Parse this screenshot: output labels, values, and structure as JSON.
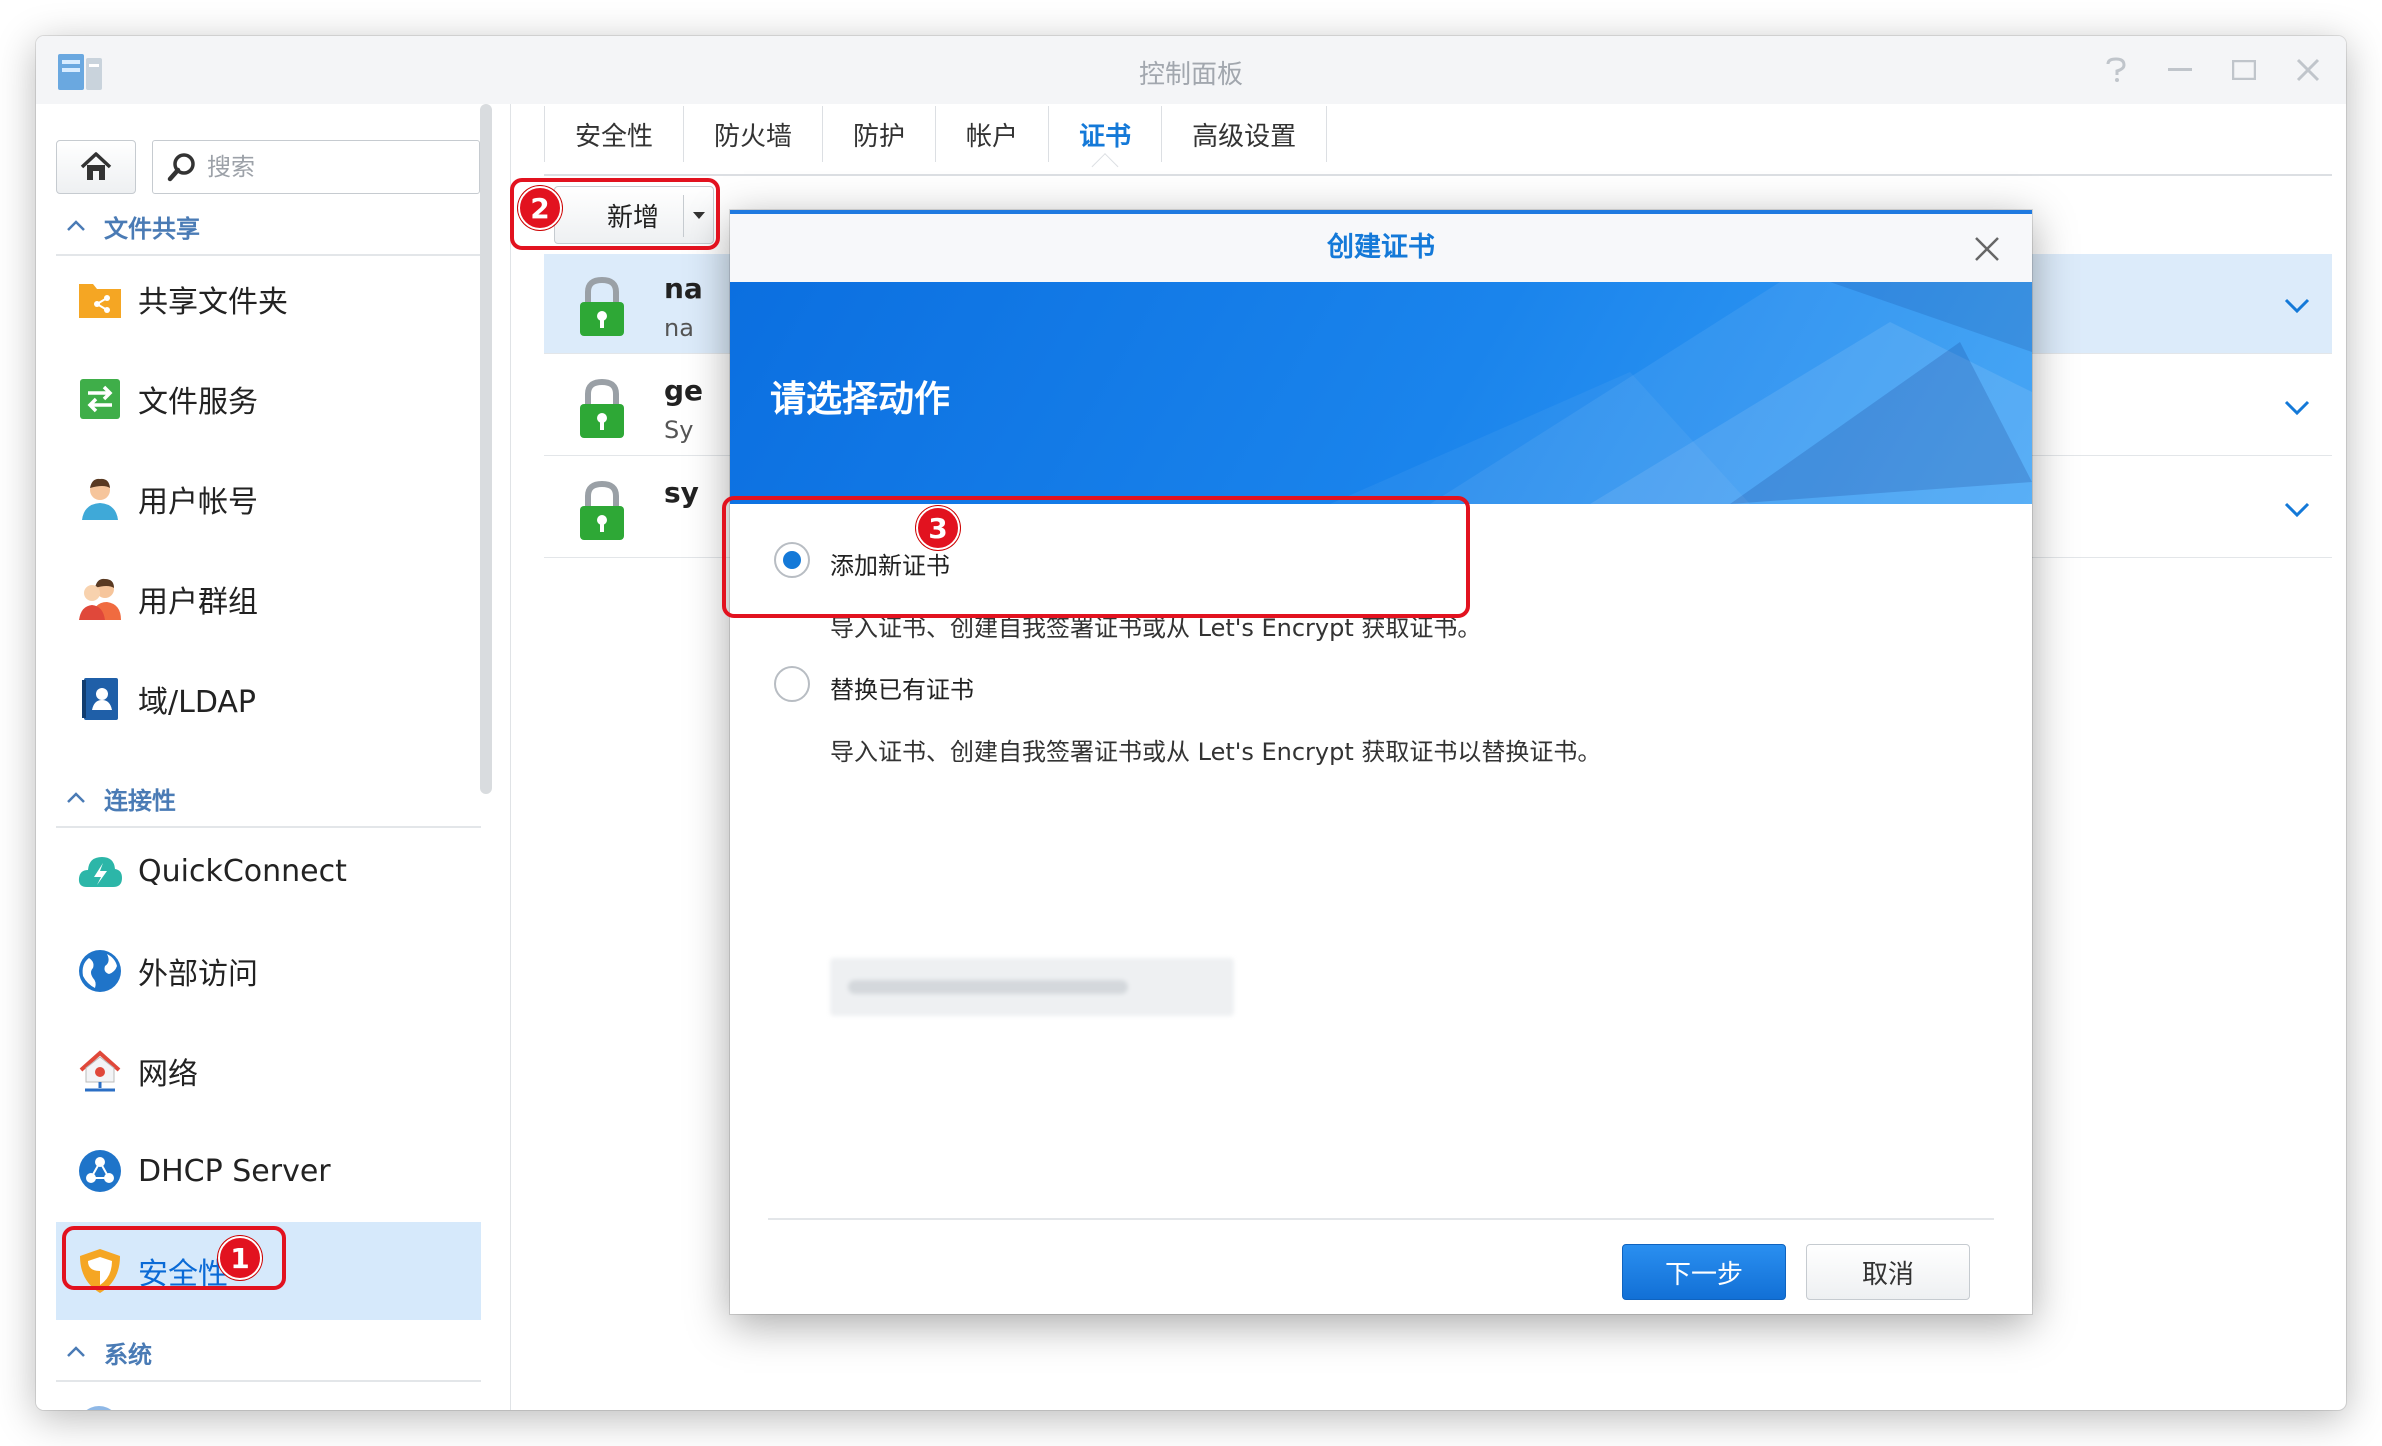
{
  "window": {
    "title": "控制面板",
    "controls": [
      "help-icon",
      "minimize-icon",
      "maximize-icon",
      "close-icon"
    ]
  },
  "sidebar": {
    "search_placeholder": "搜索",
    "sections": {
      "file_sharing": "文件共享",
      "connectivity": "连接性",
      "system": "系统"
    },
    "items": [
      {
        "label": "共享文件夹",
        "icon": "shared-folder-icon"
      },
      {
        "label": "文件服务",
        "icon": "file-services-icon"
      },
      {
        "label": "用户帐号",
        "icon": "user-account-icon"
      },
      {
        "label": "用户群组",
        "icon": "user-group-icon"
      },
      {
        "label": "域/LDAP",
        "icon": "domain-ldap-icon"
      },
      {
        "label": "QuickConnect",
        "icon": "quickconnect-icon"
      },
      {
        "label": "外部访问",
        "icon": "external-access-icon"
      },
      {
        "label": "网络",
        "icon": "network-icon"
      },
      {
        "label": "DHCP Server",
        "icon": "dhcp-server-icon"
      },
      {
        "label": "安全性",
        "icon": "security-shield-icon",
        "active": true
      }
    ]
  },
  "tabs": [
    "安全性",
    "防火墙",
    "防护",
    "帐户",
    "证书",
    "高级设置"
  ],
  "active_tab": "证书",
  "toolbar": {
    "add_label": "新增"
  },
  "cert_list": [
    {
      "name": "na",
      "sub": "na"
    },
    {
      "name": "ge",
      "sub": "Sy"
    },
    {
      "name": "sy",
      "sub": ""
    }
  ],
  "dialog": {
    "title": "创建证书",
    "heading": "请选择动作",
    "options": [
      {
        "label": "添加新证书",
        "desc": "导入证书、创建自我签署证书或从 Let's Encrypt 获取证书。",
        "selected": true
      },
      {
        "label": "替换已有证书",
        "desc": "导入证书、创建自我签署证书或从 Let's Encrypt 获取证书以替换证书。",
        "selected": false
      }
    ],
    "next_label": "下一步",
    "cancel_label": "取消"
  },
  "annotations": [
    "1",
    "2",
    "3"
  ],
  "colors": {
    "accent": "#1479d8",
    "callout": "#e2121f",
    "banner": "#1a84ec",
    "lock_green": "#2ea836"
  }
}
